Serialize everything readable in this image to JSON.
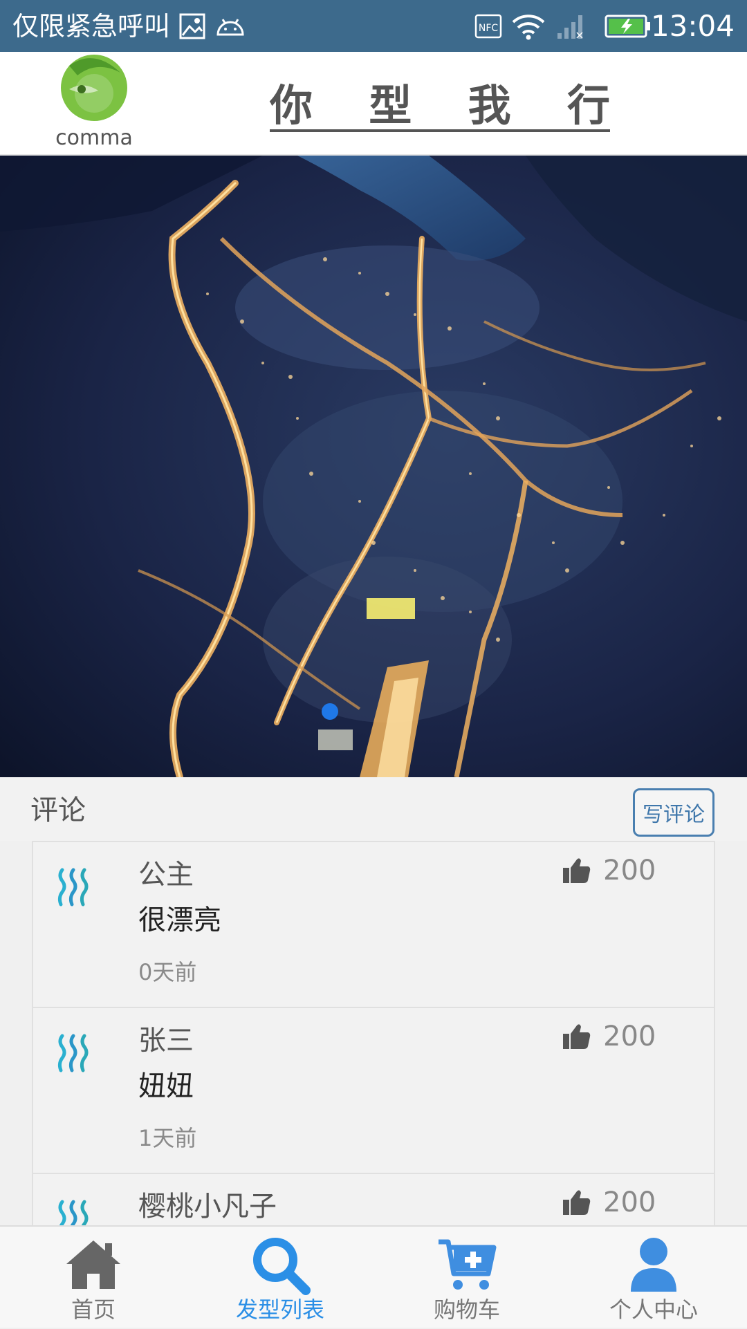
{
  "status_bar": {
    "carrier_text": "仅限紧急呼叫",
    "time": "13:04",
    "icons": [
      "image-icon",
      "android-icon",
      "nfc-icon",
      "wifi-icon",
      "signal-icon",
      "battery-charging-icon"
    ]
  },
  "header": {
    "logo_text": "comma",
    "title_chars": [
      "你",
      "型",
      "我",
      "行"
    ]
  },
  "banner": {
    "image_description_icon": "city-night-aerial-photo",
    "active_slide": 1
  },
  "comments": {
    "title": "评论",
    "write_button": "写评论",
    "items": [
      {
        "user": "公主",
        "text": "很漂亮",
        "time": "0天前",
        "likes": "200"
      },
      {
        "user": "张三",
        "text": "妞妞",
        "time": "1天前",
        "likes": "200"
      },
      {
        "user": "樱桃小凡子",
        "text": "",
        "time": "",
        "likes": "200"
      }
    ]
  },
  "bottom_nav": {
    "items": [
      {
        "label": "首页",
        "icon": "home-icon",
        "active": false
      },
      {
        "label": "发型列表",
        "icon": "search-icon",
        "active": true
      },
      {
        "label": "购物车",
        "icon": "cart-icon",
        "active": false
      },
      {
        "label": "个人中心",
        "icon": "user-icon",
        "active": false
      }
    ]
  },
  "colors": {
    "status_bar": "#3d6a8c",
    "accent": "#2b8fe6",
    "header_text": "#555555",
    "logo_green": "#7cc242"
  }
}
